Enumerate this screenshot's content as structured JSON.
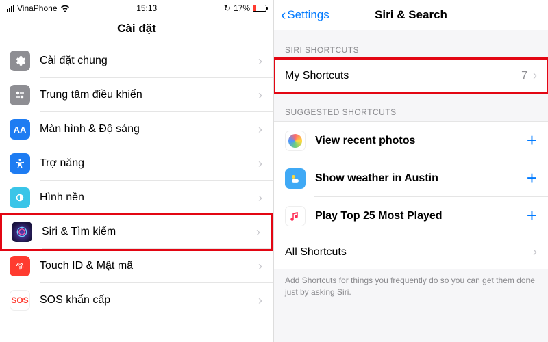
{
  "left": {
    "status": {
      "carrier": "VinaPhone",
      "time": "15:13",
      "battery_pct": "17%"
    },
    "title": "Cài đặt",
    "rows": [
      {
        "label": "Cài đặt chung"
      },
      {
        "label": "Trung tâm điều khiển"
      },
      {
        "label": "Màn hình & Độ sáng"
      },
      {
        "label": "Trợ năng"
      },
      {
        "label": "Hình nền"
      },
      {
        "label": "Siri & Tìm kiếm"
      },
      {
        "label": "Touch ID & Mật mã"
      },
      {
        "label": "SOS khẩn cấp"
      }
    ]
  },
  "right": {
    "back": "Settings",
    "title": "Siri & Search",
    "section_shortcuts": "SIRI SHORTCUTS",
    "my_shortcuts": {
      "label": "My Shortcuts",
      "count": "7"
    },
    "section_suggested": "SUGGESTED SHORTCUTS",
    "suggested": [
      {
        "label": "View recent photos"
      },
      {
        "label": "Show weather in Austin"
      },
      {
        "label": "Play Top 25 Most Played"
      }
    ],
    "all_shortcuts": "All Shortcuts",
    "footer": "Add Shortcuts for things you frequently do so you can get them done just by asking Siri."
  }
}
